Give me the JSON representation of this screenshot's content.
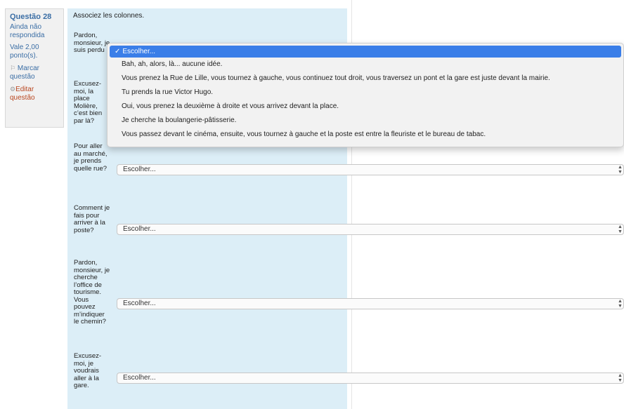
{
  "question_info": {
    "number": "Questão 28",
    "status": "Ainda não respondida",
    "grade": "Vale 2,00 ponto(s).",
    "flag_label": "Marcar questão",
    "edit_label": "Editar questão"
  },
  "question": {
    "text": "Associez les colonnes.",
    "prompts": [
      "Pardon, monsieur, je suis perdu",
      "Excusez-moi, la place Molière, c’est bien par là?",
      "Pour aller au marché, je prends quelle rue?",
      "Comment je fais pour arriver à la poste?",
      "Pardon, monsieur, je cherche l’office de tourisme. Vous pouvez m’indiquer le chemin?",
      "Excusez-moi, je voudrais aller à la gare."
    ],
    "select_value": "Escolher..."
  },
  "dropdown": {
    "options": [
      "Escolher...",
      "Bah, ah, alors, là... aucune idée.",
      "Vous prenez la Rue de Lille, vous tournez à gauche, vous continuez tout droit, vous traversez un pont et la gare est juste devant la mairie.",
      "Tu prends la rue Victor Hugo.",
      "Oui, vous prenez la deuxième à droite et vous arrivez devant la place.",
      "Je cherche la boulangerie-pâtisserie.",
      "Vous passez devant le cinéma, ensuite, vous tournez à gauche et la poste est entre la fleuriste et le bureau de tabac."
    ],
    "selected_index": 0
  },
  "colors": {
    "panel_bg": "#dceef7",
    "link": "#3b6ea5",
    "highlight": "#3a7ee8"
  }
}
